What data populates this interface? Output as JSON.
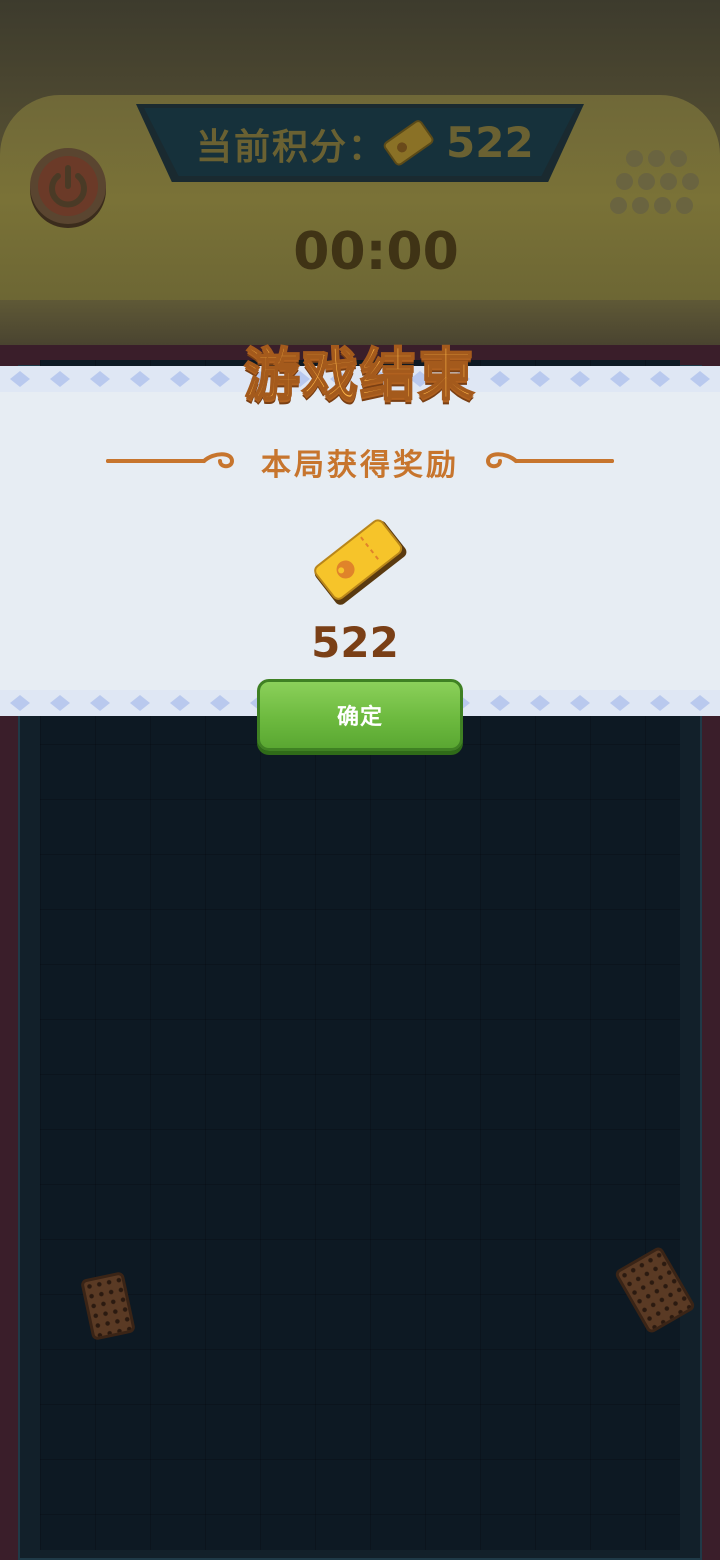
{
  "hud": {
    "score_label": "当前积分：",
    "score_value": "522",
    "timer": "00:00",
    "power_icon": "power-icon",
    "menu_icon": "dot-grid-icon"
  },
  "result_modal": {
    "title": "游戏结束",
    "reward_heading": "本局获得奖励",
    "reward_icon": "ticket-icon",
    "reward_value": "522",
    "confirm_label": "确定"
  },
  "colors": {
    "title_orange": "#ffb84a",
    "heading_orange": "#c7752d",
    "value_brown": "#7a3f16",
    "button_green": "#6dba3f",
    "ticket_gold": "#f6c42a"
  }
}
